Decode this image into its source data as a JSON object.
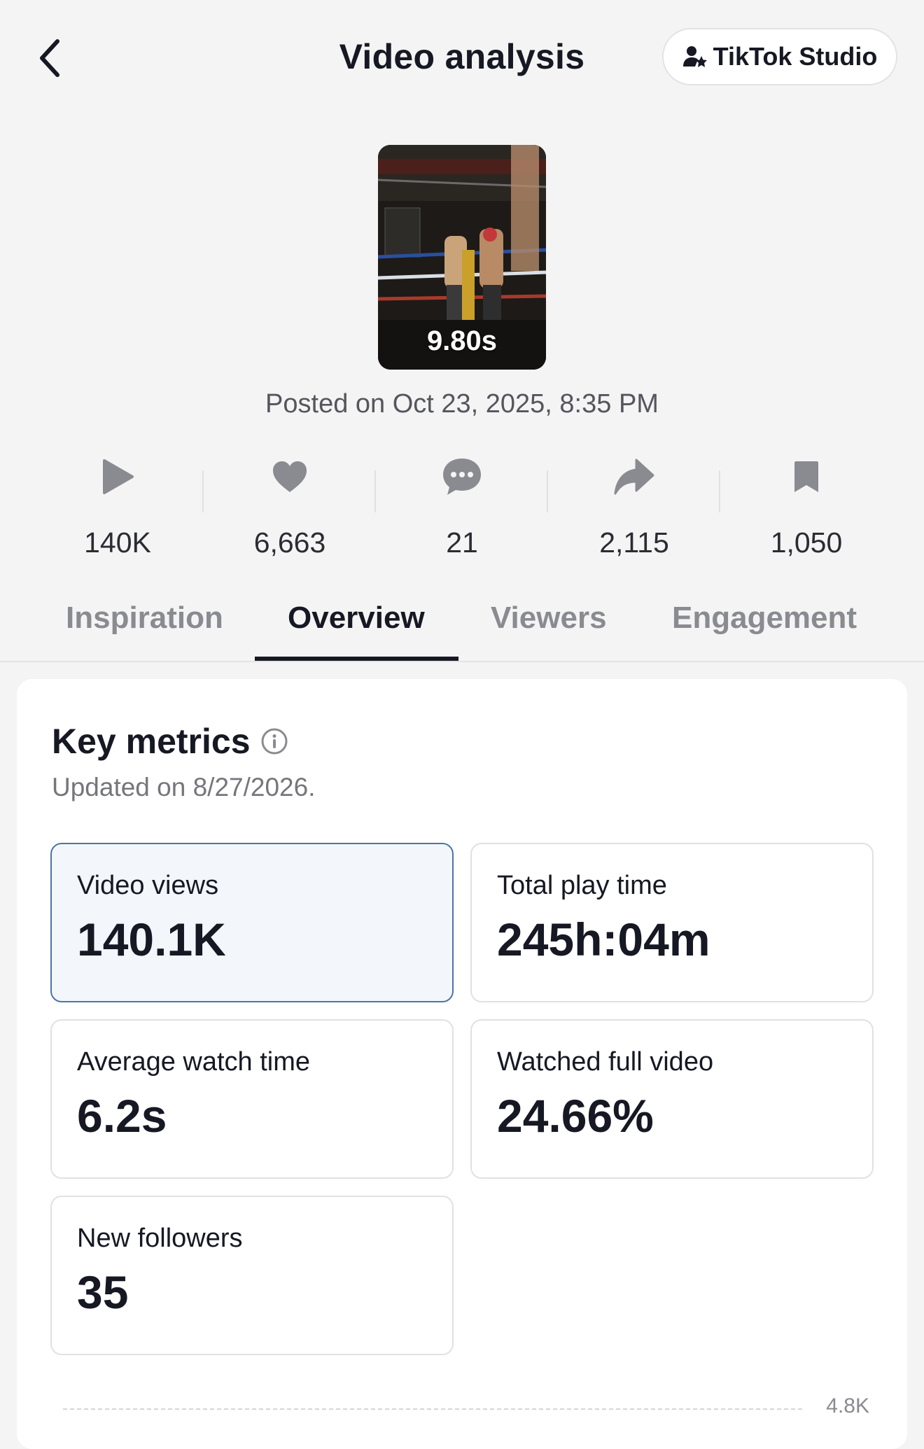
{
  "header": {
    "title": "Video analysis",
    "studio_button_label": "TikTok Studio"
  },
  "video": {
    "thumbnail_caption": "9.80s",
    "posted": "Posted on Oct 23, 2025, 8:35 PM"
  },
  "stats": [
    {
      "icon": "play-icon",
      "value": "140K"
    },
    {
      "icon": "heart-icon",
      "value": "6,663"
    },
    {
      "icon": "comment-icon",
      "value": "21"
    },
    {
      "icon": "share-icon",
      "value": "2,115"
    },
    {
      "icon": "bookmark-icon",
      "value": "1,050"
    }
  ],
  "tabs": [
    {
      "label": "Inspiration",
      "active": false
    },
    {
      "label": "Overview",
      "active": true
    },
    {
      "label": "Viewers",
      "active": false
    },
    {
      "label": "Engagement",
      "active": false
    }
  ],
  "key_metrics": {
    "title": "Key metrics",
    "updated": "Updated on 8/27/2026.",
    "metrics": [
      {
        "label": "Video views",
        "value": "140.1K",
        "selected": true
      },
      {
        "label": "Total play time",
        "value": "245h:04m",
        "selected": false
      },
      {
        "label": "Average watch time",
        "value": "6.2s",
        "selected": false
      },
      {
        "label": "Watched full video",
        "value": "24.66%",
        "selected": false
      },
      {
        "label": "New followers",
        "value": "35",
        "selected": false
      }
    ]
  },
  "chart": {
    "top_tick": "4.8K"
  },
  "colors": {
    "background": "#f4f4f4",
    "text_primary": "#161823",
    "text_secondary": "#75767c",
    "selected_border": "#4a76a8",
    "selected_fill": "#f3f6fa"
  }
}
